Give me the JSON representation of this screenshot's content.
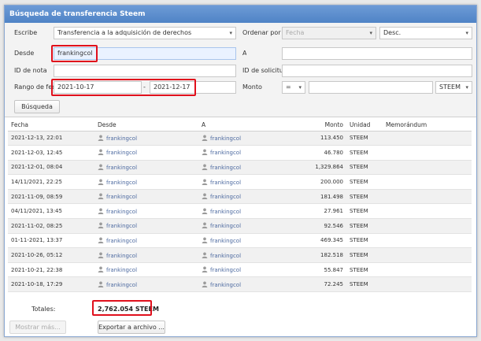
{
  "window": {
    "title": "Búsqueda de transferencia Steem"
  },
  "form": {
    "type_label": "Escribe",
    "type_value": "Transferencia a la adquisición de derechos",
    "order_label": "Ordenar por",
    "order_value": "Fecha",
    "order_dir_value": "Desc.",
    "from_label": "Desde",
    "from_value": "frankingcol",
    "to_label": "A",
    "to_value": "",
    "memo_id_label": "ID de nota",
    "memo_id_value": "",
    "request_id_label": "ID de solicitud",
    "request_id_value": "",
    "date_range_label": "Rango de fechas",
    "date_from": "2021-10-17",
    "date_sep": "-",
    "date_to": "2021-12-17",
    "amount_label": "Monto",
    "amount_op": "=",
    "amount_value": "",
    "currency_value": "STEEM",
    "search_button": "Búsqueda"
  },
  "table": {
    "columns": [
      "Fecha",
      "Desde",
      "A",
      "Monto",
      "Unidad",
      "Memorándum"
    ],
    "rows": [
      {
        "date": "2021-12-13, 22:01",
        "from": "frankingcol",
        "to": "frankingcol",
        "amount": "113.450",
        "unit": "STEEM",
        "memo": ""
      },
      {
        "date": "2021-12-03, 12:45",
        "from": "frankingcol",
        "to": "frankingcol",
        "amount": "46.780",
        "unit": "STEEM",
        "memo": ""
      },
      {
        "date": "2021-12-01, 08:04",
        "from": "frankingcol",
        "to": "frankingcol",
        "amount": "1,329.864",
        "unit": "STEEM",
        "memo": ""
      },
      {
        "date": "14/11/2021, 22:25",
        "from": "frankingcol",
        "to": "frankingcol",
        "amount": "200.000",
        "unit": "STEEM",
        "memo": ""
      },
      {
        "date": "2021-11-09, 08:59",
        "from": "frankingcol",
        "to": "frankingcol",
        "amount": "181.498",
        "unit": "STEEM",
        "memo": ""
      },
      {
        "date": "04/11/2021, 13:45",
        "from": "frankingcol",
        "to": "frankingcol",
        "amount": "27.961",
        "unit": "STEEM",
        "memo": ""
      },
      {
        "date": "2021-11-02, 08:25",
        "from": "frankingcol",
        "to": "frankingcol",
        "amount": "92.546",
        "unit": "STEEM",
        "memo": ""
      },
      {
        "date": "01-11-2021, 13:37",
        "from": "frankingcol",
        "to": "frankingcol",
        "amount": "469.345",
        "unit": "STEEM",
        "memo": ""
      },
      {
        "date": "2021-10-26, 05:12",
        "from": "frankingcol",
        "to": "frankingcol",
        "amount": "182.518",
        "unit": "STEEM",
        "memo": ""
      },
      {
        "date": "2021-10-21, 22:38",
        "from": "frankingcol",
        "to": "frankingcol",
        "amount": "55.847",
        "unit": "STEEM",
        "memo": ""
      },
      {
        "date": "2021-10-18, 17:29",
        "from": "frankingcol",
        "to": "frankingcol",
        "amount": "72.245",
        "unit": "STEEM",
        "memo": ""
      }
    ]
  },
  "totals": {
    "label": "Totales:",
    "value": "2,762.054 STEEM"
  },
  "footer": {
    "more_button": "Mostrar más...",
    "export_button": "Exportar a archivo ..."
  },
  "colors": {
    "titlebar": "#5b8ccd",
    "highlight": "#e0101c",
    "link": "#4d6aa0"
  },
  "icons": {
    "user": "user-icon",
    "dropdown": "chevron-down-icon"
  }
}
